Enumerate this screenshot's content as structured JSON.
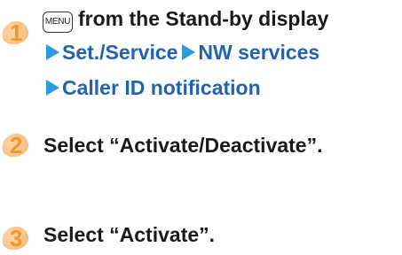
{
  "steps": [
    {
      "number": "1",
      "menu_key": "MENU",
      "line1_text": "from the Stand-by display",
      "nav1": "Set./Service",
      "nav2": "NW services",
      "nav3": "Caller ID notification"
    },
    {
      "number": "2",
      "text": "Select “Activate/Deactivate”."
    },
    {
      "number": "3",
      "text": "Select “Activate”."
    }
  ],
  "colors": {
    "step_number": "#f0962c",
    "badge_fill": "#f7c48a",
    "nav_text": "#1f63b4",
    "nav_arrow": "#2a9be0",
    "body_text": "#1a1a1a"
  },
  "icons": {
    "menu_key": "menu-key-icon",
    "nav_arrow": "triangle-right-icon"
  }
}
